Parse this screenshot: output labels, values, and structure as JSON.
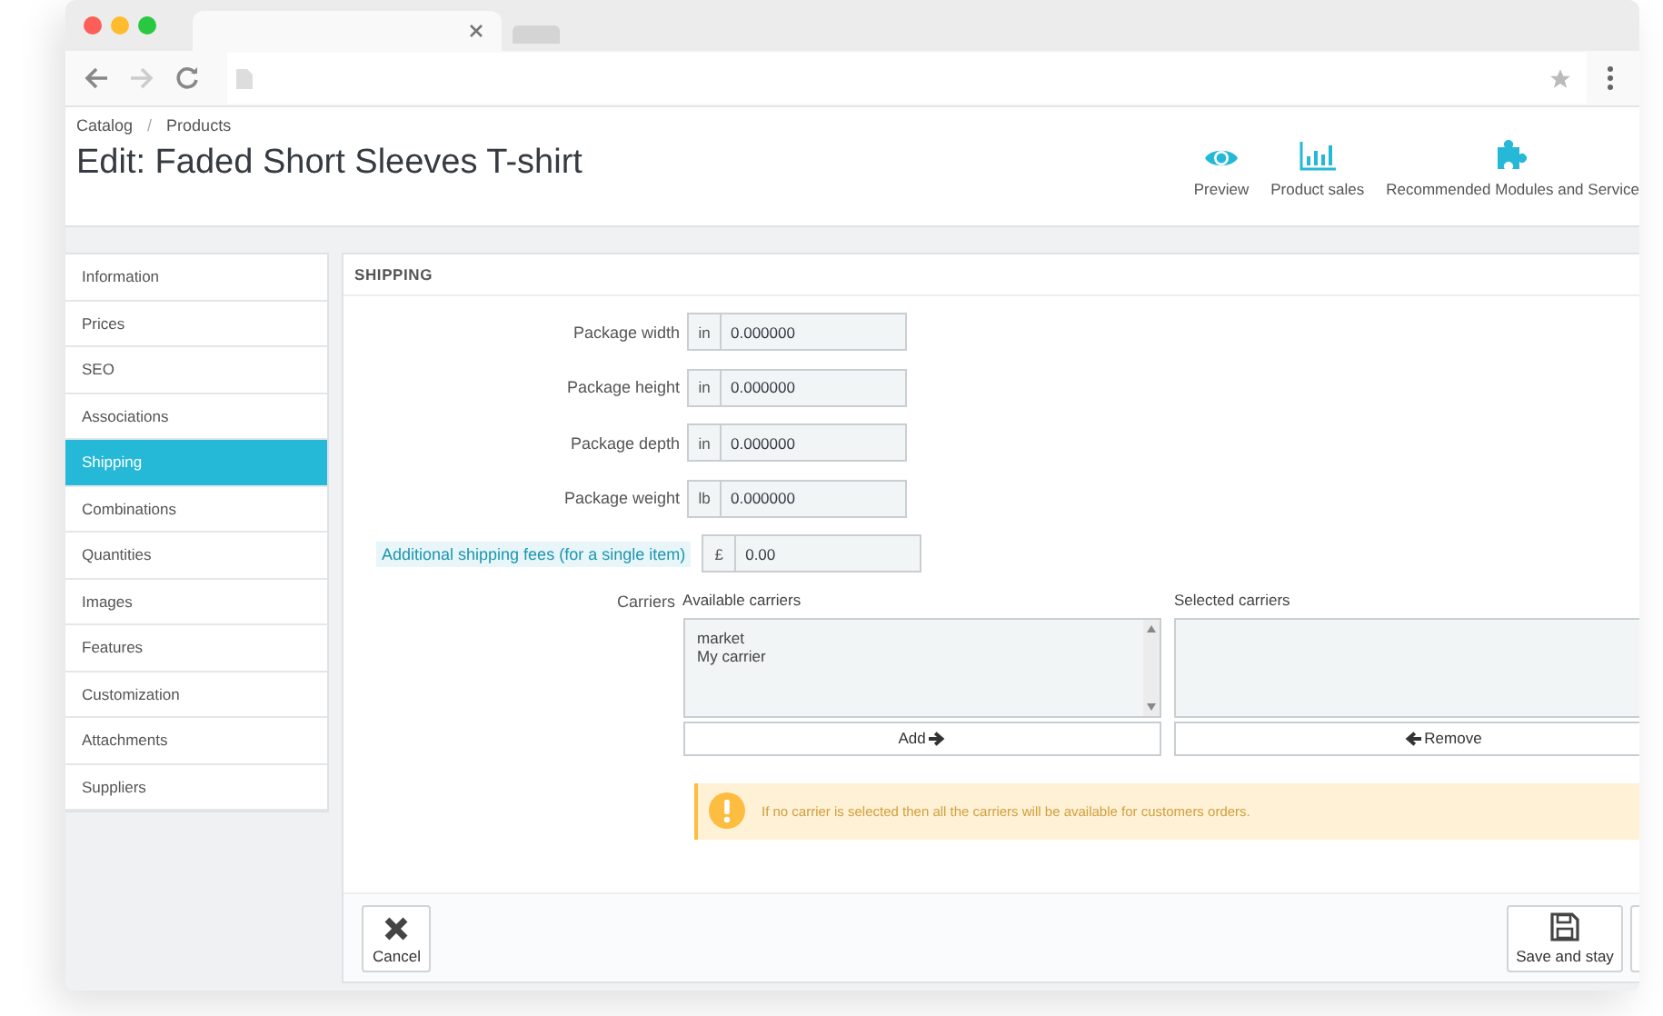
{
  "breadcrumb": [
    "Catalog",
    "Products"
  ],
  "breadcrumb_separator": "/",
  "title": "Edit: Faded Short Sleeves T-shirt",
  "toolbar_actions": [
    {
      "label": "Preview",
      "kind": "eye"
    },
    {
      "label": "Product sales",
      "kind": "chart"
    },
    {
      "label": "Recommended Modules and Service",
      "kind": "puzzle"
    }
  ],
  "sidebar": {
    "items": [
      {
        "label": "Information",
        "selected": false
      },
      {
        "label": "Prices",
        "selected": false
      },
      {
        "label": "SEO",
        "selected": false
      },
      {
        "label": "Associations",
        "selected": false
      },
      {
        "label": "Shipping",
        "selected": true
      },
      {
        "label": "Combinations",
        "selected": false
      },
      {
        "label": "Quantities",
        "selected": false
      },
      {
        "label": "Images",
        "selected": false
      },
      {
        "label": "Features",
        "selected": false
      },
      {
        "label": "Customization",
        "selected": false
      },
      {
        "label": "Attachments",
        "selected": false
      },
      {
        "label": "Suppliers",
        "selected": false
      }
    ]
  },
  "panel": {
    "title": "SHIPPING",
    "fields": [
      {
        "label": "Package width",
        "kind": "plain",
        "unit": "in",
        "value": "0.000000"
      },
      {
        "label": "Package height",
        "kind": "plain",
        "unit": "in",
        "value": "0.000000"
      },
      {
        "label": "Package depth",
        "kind": "plain",
        "unit": "in",
        "value": "0.000000"
      },
      {
        "label": "Package weight",
        "kind": "plain",
        "unit": "lb",
        "value": "0.000000"
      },
      {
        "label": "Additional shipping fees (for a single item)",
        "kind": "help",
        "unit": "£",
        "value": "0.00"
      }
    ],
    "carriers": {
      "label": "Carriers",
      "available": {
        "title": "Available carriers",
        "items": [
          "market",
          "My carrier"
        ],
        "button": "Add"
      },
      "selected": {
        "title": "Selected carriers",
        "button": "Remove"
      }
    },
    "warning": "If no carrier is selected then all the carriers will be available for customers orders.",
    "footer_buttons": [
      {
        "label": "Cancel",
        "kind": "cancel"
      },
      {
        "label": "Save and stay",
        "kind": "save"
      }
    ]
  }
}
